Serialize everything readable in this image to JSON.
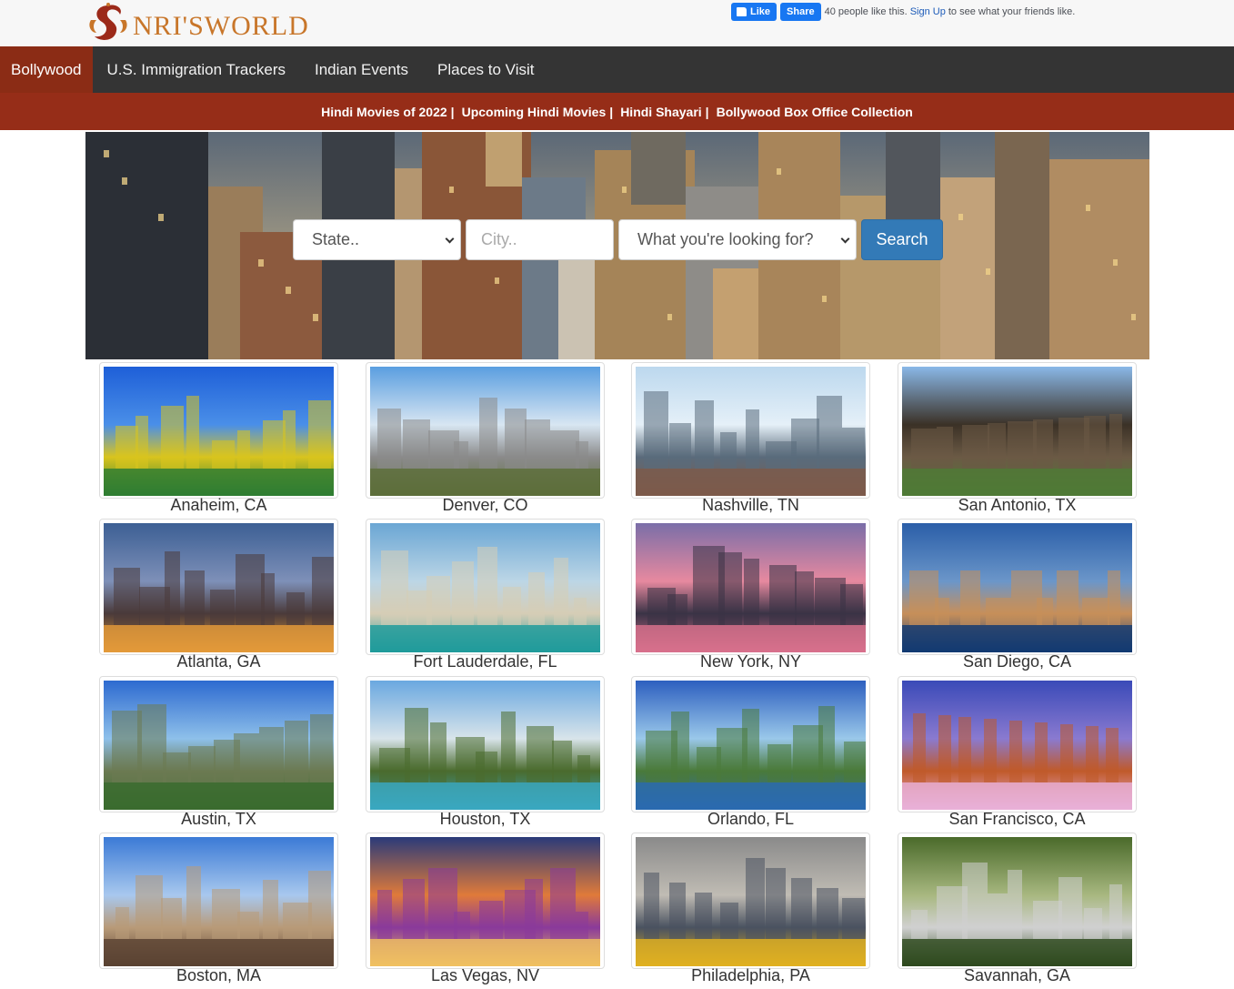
{
  "header": {
    "logo_text": "NRI'SWORLD",
    "fb_like": "Like",
    "fb_share": "Share",
    "fb_text_1": "40 people like this.",
    "fb_signup": "Sign Up",
    "fb_text_2": "to see what your friends like."
  },
  "nav": {
    "items": [
      {
        "label": "Bollywood"
      },
      {
        "label": "U.S. Immigration Trackers"
      },
      {
        "label": "Indian Events"
      },
      {
        "label": "Places to Visit"
      }
    ]
  },
  "subnav": {
    "links": [
      {
        "label": "Hindi Movies of 2022"
      },
      {
        "label": "Upcoming Hindi Movies"
      },
      {
        "label": "Hindi Shayari"
      },
      {
        "label": "Bollywood Box Office Collection"
      }
    ],
    "separator": "|"
  },
  "search": {
    "state_selected": "State..",
    "city_placeholder": "City..",
    "what_selected": "What you're looking for?",
    "button": "Search"
  },
  "cities": [
    {
      "name": "Anaheim, CA",
      "colors": [
        "#1e5fd8",
        "#4a8fe8",
        "#d9c41e",
        "#2e7d32"
      ]
    },
    {
      "name": "Denver, CO",
      "colors": [
        "#5a9ee0",
        "#d8e6f2",
        "#8a8a8a",
        "#5d6e3a"
      ]
    },
    {
      "name": "Nashville, TN",
      "colors": [
        "#bcd8ee",
        "#e5f0f8",
        "#5a6b7b",
        "#7d5a4a"
      ]
    },
    {
      "name": "San Antonio, TX",
      "colors": [
        "#8ab8e8",
        "#3b3126",
        "#6b5a45",
        "#4f7a36"
      ]
    },
    {
      "name": "Atlanta, GA",
      "colors": [
        "#3c5f94",
        "#7e90b8",
        "#4a3a3a",
        "#e39a3a"
      ]
    },
    {
      "name": "Fort Lauderdale, FL",
      "colors": [
        "#6aa6d4",
        "#bcd6e6",
        "#d6cdb6",
        "#1f9b9b"
      ]
    },
    {
      "name": "New York, NY",
      "colors": [
        "#7a6ea8",
        "#e7899f",
        "#3a3346",
        "#d8708c"
      ]
    },
    {
      "name": "San Diego, CA",
      "colors": [
        "#2a5ea8",
        "#6b96c9",
        "#c78f5a",
        "#123a72"
      ]
    },
    {
      "name": "Austin, TX",
      "colors": [
        "#2d6ad0",
        "#8ec0ea",
        "#6b7a52",
        "#3a6b2e"
      ]
    },
    {
      "name": "Houston, TX",
      "colors": [
        "#6aa8e0",
        "#d8e4ea",
        "#4a6b2e",
        "#3aa8c0"
      ]
    },
    {
      "name": "Orlando, FL",
      "colors": [
        "#2d5fbf",
        "#9ac8ea",
        "#4a7a3a",
        "#2a6ab0"
      ]
    },
    {
      "name": "San Francisco, CA",
      "colors": [
        "#3a4ab8",
        "#8a7ad0",
        "#c05a2a",
        "#e8b0d8"
      ]
    },
    {
      "name": "Boston, MA",
      "colors": [
        "#3b7ad6",
        "#a8c8ee",
        "#b89a78",
        "#5a4232"
      ]
    },
    {
      "name": "Las Vegas, NV",
      "colors": [
        "#2a3a7a",
        "#e07a3a",
        "#8a3a9a",
        "#f0c060"
      ]
    },
    {
      "name": "Philadelphia, PA",
      "colors": [
        "#8a8a8a",
        "#c0bcb4",
        "#4a5260",
        "#e0b020"
      ]
    },
    {
      "name": "Savannah, GA",
      "colors": [
        "#4a6a2a",
        "#a8b880",
        "#d0d0d0",
        "#2e4a1e"
      ]
    }
  ]
}
